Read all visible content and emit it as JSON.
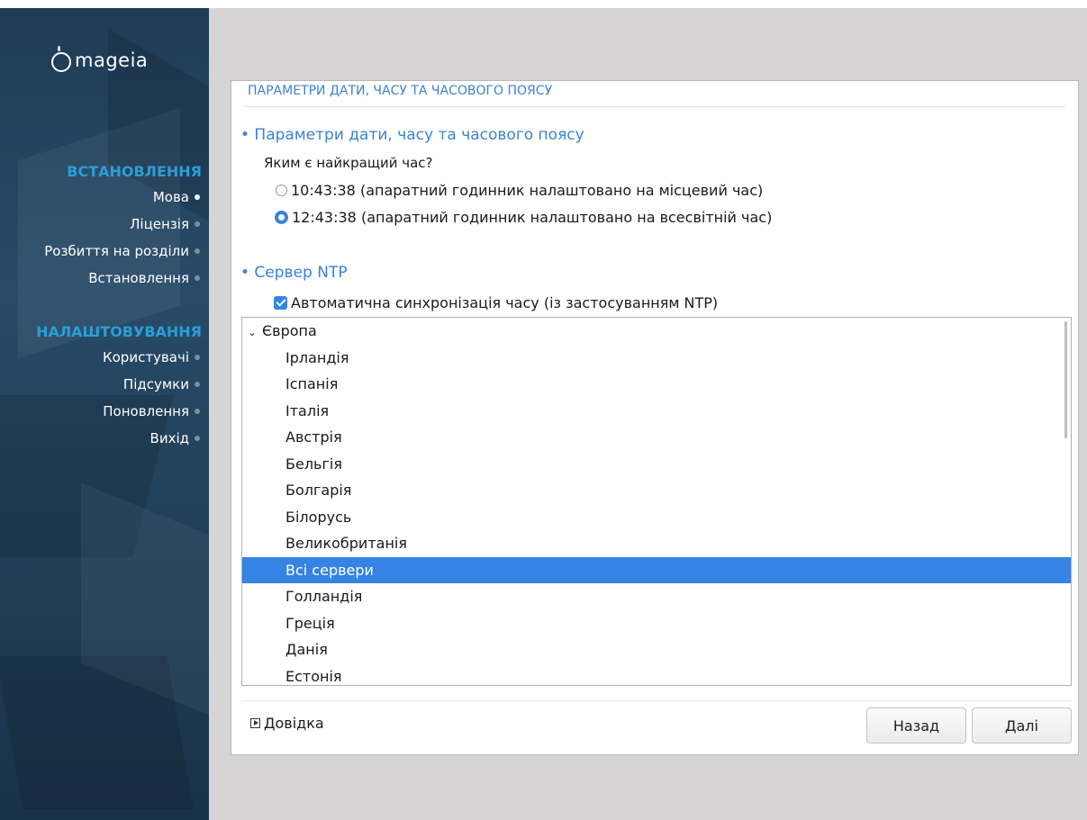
{
  "brand": {
    "name": "mageia"
  },
  "sidebar": {
    "install_heading": "ВСТАНОВЛЕННЯ",
    "install_items": [
      {
        "label": "Мова",
        "current": true
      },
      {
        "label": "Ліцензія",
        "current": false
      },
      {
        "label": "Розбиття на розділи",
        "current": false
      },
      {
        "label": "Встановлення",
        "current": false
      }
    ],
    "config_heading": "НАЛАШТОВУВАННЯ",
    "config_items": [
      {
        "label": "Користувачі",
        "current": false
      },
      {
        "label": "Підсумки",
        "current": false
      },
      {
        "label": "Поновлення",
        "current": false
      },
      {
        "label": "Вихід",
        "current": false
      }
    ]
  },
  "dialog": {
    "title": "ПАРАМЕТРИ ДАТИ, ЧАСУ ТА ЧАСОВОГО ПОЯСУ",
    "section_time": "• Параметри дати, часу та часового поясу",
    "question": "Яким є найкращий час?",
    "options": [
      {
        "label": "10:43:38 (апаратний годинник налаштовано на місцевий час)",
        "checked": false
      },
      {
        "label": "12:43:38 (апаратний годинник налаштовано на всесвітній час)",
        "checked": true
      }
    ],
    "section_ntp": "• Сервер NTP",
    "auto_sync": {
      "label": "Автоматична синхронізація часу (із застосуванням NTP)",
      "checked": true
    },
    "ntp_list": {
      "group": "Європа",
      "expanded": true,
      "items": [
        "Ірландія",
        "Іспанія",
        "Італія",
        "Австрія",
        "Бельгія",
        "Болгарія",
        "Білорусь",
        "Великобританія",
        "Всі сервери",
        "Голландія",
        "Греція",
        "Данія",
        "Естонія"
      ],
      "selected": "Всі сервери"
    },
    "help_label": "Довідка",
    "back_label": "Назад",
    "next_label": "Далі"
  },
  "colors": {
    "accent": "#3584e4",
    "heading": "#3c82d6",
    "sidebar_heading": "#2a9fd6"
  }
}
